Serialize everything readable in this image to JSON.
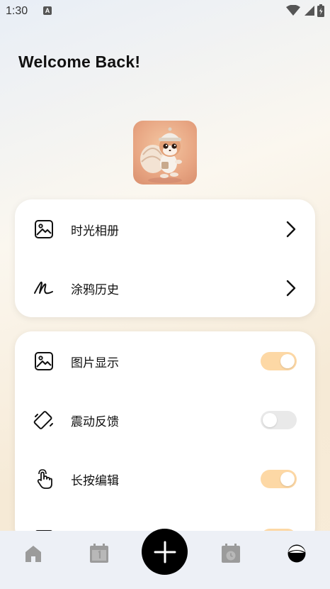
{
  "status_bar": {
    "time": "1:30",
    "notification_badge": "A"
  },
  "welcome_text": "Welcome Back!",
  "menu_card": {
    "items": [
      {
        "label": "时光相册",
        "icon": "image-icon"
      },
      {
        "label": "涂鸦历史",
        "icon": "scribble-icon"
      }
    ]
  },
  "settings_card": {
    "items": [
      {
        "label": "图片显示",
        "icon": "image-icon",
        "enabled": true
      },
      {
        "label": "震动反馈",
        "icon": "vibration-icon",
        "enabled": false
      },
      {
        "label": "长按编辑",
        "icon": "touch-icon",
        "enabled": true
      },
      {
        "label": "",
        "icon": "calendar-icon",
        "enabled": true
      }
    ]
  },
  "bottom_nav": {
    "items": [
      "home-icon",
      "calendar-icon",
      "add-icon",
      "calendar-clock-icon",
      "profile-icon"
    ],
    "active": "profile-icon"
  },
  "colors": {
    "toggle_on": "#fdd8a5",
    "toggle_off": "#e9e9e9",
    "nav_bg": "#edf0f6",
    "fab": "#000000"
  }
}
